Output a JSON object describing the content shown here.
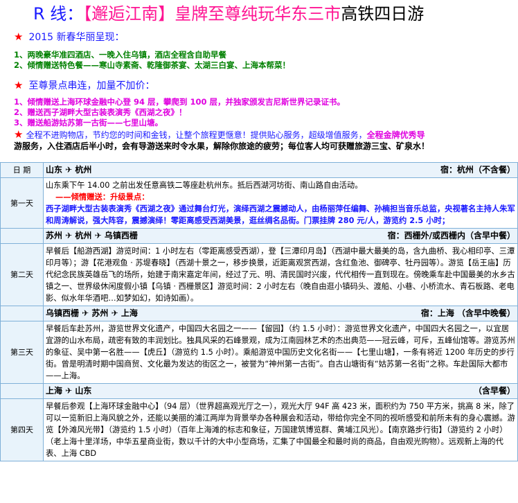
{
  "title": {
    "part1": "R 线：",
    "part2": "【邂逅江南】皇牌至尊纯玩华东三市",
    "part3": "高铁四日游"
  },
  "section1": {
    "heading": "2015 新春华丽呈现：",
    "lines": [
      "1、两晚豪华准四酒店、一晚入住乌镇，酒店全程含自助早餐",
      "2、倾情赠送特色餐——寒山寺素斋、乾隆御茶宴、太湖三白宴、上海本帮菜！"
    ]
  },
  "section2": {
    "heading": "至尊景点串连，加量不加价：",
    "lines": [
      "1、倾情赠送上海环球金融中心登 94 层，攀爬到 100 层，并独家颁发吉尼斯世界记录证书。",
      "2、赠送西子湖畔大型古装表演秀《西湖之夜》！",
      "3、赠送船游姑苏第一古街——七里山塘。"
    ]
  },
  "notice": {
    "line1_blue": "全程不进购物店，节约您的时间和金钱，让整个旅程更惬意！提供贴心服务，超级增值服务，",
    "line1_mag": "全程金牌优秀导",
    "line2": "游服务，入住酒店后半小时，会有导游送来时令水果，解除你旅途的疲劳；每位客人均可获赠旅游三宝、矿泉水！"
  },
  "table": {
    "header_label": "日 期",
    "rows": [
      {
        "day": "",
        "route": "山东 ✈ 杭州",
        "stay": "宿：杭州（不含餐）",
        "content": ""
      }
    ],
    "day1": {
      "label": "第一天",
      "text1": "山东乘下午 14.00 之前出发任意高铁二等座赴杭州东。抵后西湖河坊街、南山路自由活动。",
      "gift": "——倾情赠送：升级景点：",
      "text2": "西子湖畔大型古装表演秀《西湖之夜》通过舞台灯光，演绎西湖之震撼动人，由杨丽萍任编舞、孙楠担当音乐总监，央视著名主持人朱军和周涛解说，强大阵容，震撼演绎！零距离感受西湖美景，逛丝绸名品街。门票挂牌 280 元/人，游览约 2.5 小时；"
    },
    "day2": {
      "label": "第二天",
      "route": "苏州 ✈ 杭州 ✈ 乌镇西栅",
      "stay": "宿：西栅外/或西栅内（含早中餐）",
      "text": "早餐后【船游西湖】游览时间：1 小时左右（零距离感受西湖），登【三潭印月岛】（西湖中最大最美的岛，含九曲桥、我心相印亭、三潭印月等）；游【花港观鱼 · 苏堤春晓】（西湖十景之一，移步换景，近距离观赏西湖，含红鱼池、御碑亭、牡丹园等）。游览【岳王庙】历代纪念民族英雄岳飞的场所，始建于南宋嘉定年间，经过了元、明、清民国时兴废，代代相传一直到现在。傍晚乘车赴中国最美的水乡古镇之一、世界级休闲度假小镇【乌镇 · 西栅景区】游览时间：2 小时左右（晚自由逛小镇码头、渡船、小巷、小桥流水、青石板路、老电影、似水年华酒吧…如梦如幻，如诗如画）。"
    },
    "day3": {
      "label": "第三天",
      "route": "乌镇西栅 ✈ 苏州 ✈ 上海",
      "stay": "宿：上海 （含早中晚餐）",
      "text": "早餐后车赴苏州，游览世界文化遗产，中国四大名园之一——【留园】（约 1.5 小时）：游览世界文化遗产，中国四大名园之一，以宜居宜游的山水布局，疏密有致的丰润划比。独具风采的石峰景观，成为江南园林艺术的杰出典范——冠云峰，可斥，五峰仙馆等。游览苏州的象征、吴中第一名胜——【虎丘】（游览约 1.5 小时）。乘船游览中国历史文化名街——【七里山塘】，一条有将近 1200 年历史的步行街。曾是明清时期中国商贸、文化最为发达的街区之一，被誉为“神州第一古街”。自古山塘街有“姑苏第一名街”之称。车赴国际大都市——上海。"
    },
    "day4": {
      "label": "第四天",
      "route": "上海 ✈ 山东",
      "stay": "（含早餐）",
      "text": "早餐后参观【上海环球金融中心】（94 层）（世界超高观光厅之一），观光大厅 94F 高 423 米，面积约为 750 平方米，挑高 8 米，除了可以一览新旧上海风貌之外，还能以美丽的浦江两岸为背景举办各种展会和活动，带给你完全不同的视听感受和前所未有的身心震撼。游览【外滩风光带】（游览约 1.5 小时）（百年上海滩的标志和象征，万国建筑博览群、黄埔江风光）。【南京路步行街】（游览约 2 小时）（老上海十里洋场，中华五星商业街，数以千计的大中小型商场，汇集了中国最全和最时尚的商品，自由观光购物）。远观新上海的代表、上海 CBD"
    }
  }
}
